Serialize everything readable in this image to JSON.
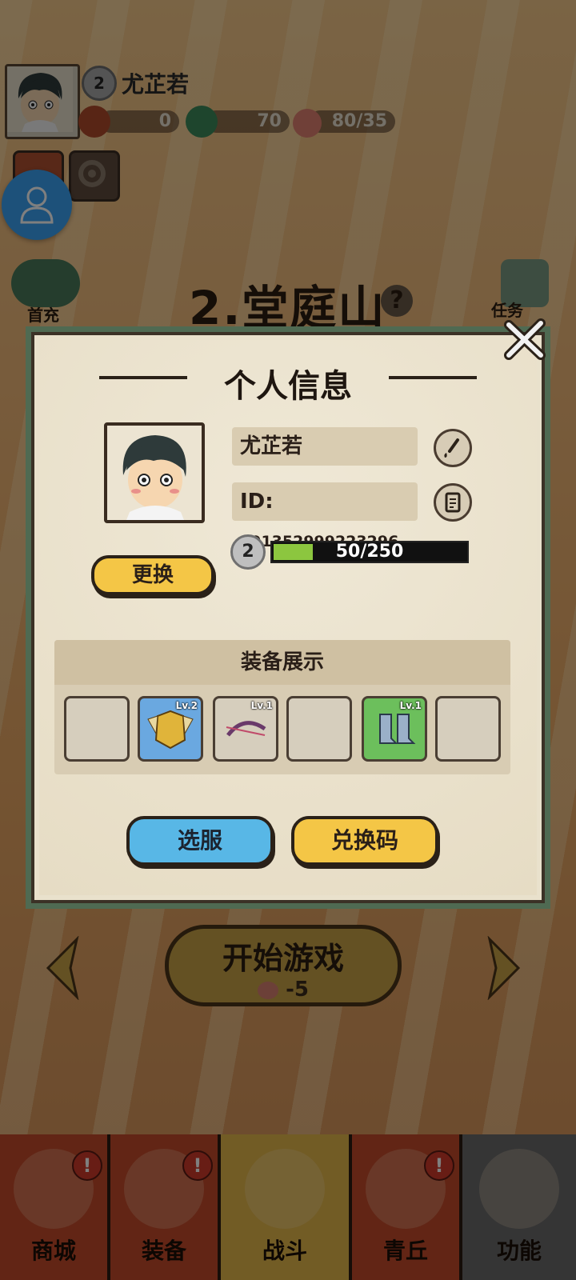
{
  "hud": {
    "level": "2",
    "player_name": "尤芷若",
    "coins": "0",
    "jade": "70",
    "stamina": "80/35"
  },
  "side": {
    "first_recharge": "首充",
    "tasks": "任务"
  },
  "stage": {
    "title": "2.堂庭山",
    "help": "?"
  },
  "start": {
    "label": "开始游戏",
    "cost": "-5"
  },
  "nav": {
    "items": [
      {
        "label": "商城",
        "alert": "!"
      },
      {
        "label": "装备",
        "alert": "!"
      },
      {
        "label": "战斗",
        "alert": ""
      },
      {
        "label": "青丘",
        "alert": "!"
      },
      {
        "label": "功能",
        "alert": ""
      }
    ]
  },
  "modal": {
    "title": "个人信息",
    "name": "尤芷若",
    "id_prefix": "ID:",
    "id_value": "391352999223296",
    "level": "2",
    "xp_text": "50/250",
    "xp_fraction": 0.2,
    "change_label": "更换",
    "equip_title": "装备展示",
    "slots": [
      {
        "level": "",
        "color": "empty"
      },
      {
        "level": "Lv.2",
        "color": "blue",
        "item": "golden-armor"
      },
      {
        "level": "Lv.1",
        "color": "empty",
        "item": "bow"
      },
      {
        "level": "",
        "color": "empty"
      },
      {
        "level": "Lv.1",
        "color": "green",
        "item": "boots"
      },
      {
        "level": "",
        "color": "empty"
      }
    ],
    "server_label": "选服",
    "redeem_label": "兑换码"
  }
}
